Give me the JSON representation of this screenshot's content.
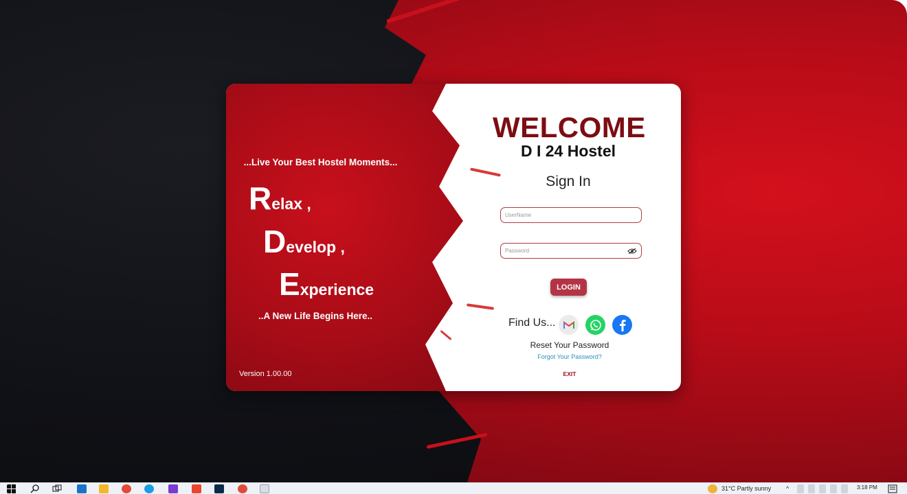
{
  "login": {
    "tagline": "...Live Your Best Hostel Moments...",
    "rde": [
      {
        "letter": "R",
        "rest": "elax ,"
      },
      {
        "letter": "D",
        "rest": "evelop ,"
      },
      {
        "letter": "E",
        "rest": "xperience"
      }
    ],
    "subline": "..A New Life Begins Here..",
    "version": "Version 1.00.00",
    "welcome": "WELCOME",
    "hostel_name": "D I 24  Hostel",
    "signin_title": "Sign In",
    "username_placeholder": "UserName",
    "password_placeholder": "Password",
    "login_label": "LOGIN",
    "findus_label": "Find Us...",
    "reset_label": "Reset Your Password",
    "forgot_label": "Forgot Your Password?",
    "exit_label": "EXIT"
  },
  "social": {
    "gmail_icon": "gmail-icon",
    "whatsapp_icon": "whatsapp-icon",
    "facebook_icon": "facebook-icon",
    "colors": {
      "gmail": "#ebebeb",
      "whatsapp": "#25d366",
      "facebook": "#1877f2"
    }
  },
  "taskbar": {
    "weather": "31°C  Partly sunny",
    "time": "3:18 PM"
  },
  "colors": {
    "accent": "#7c0d12",
    "button": "#b43446",
    "background_red": "#c8101c"
  }
}
